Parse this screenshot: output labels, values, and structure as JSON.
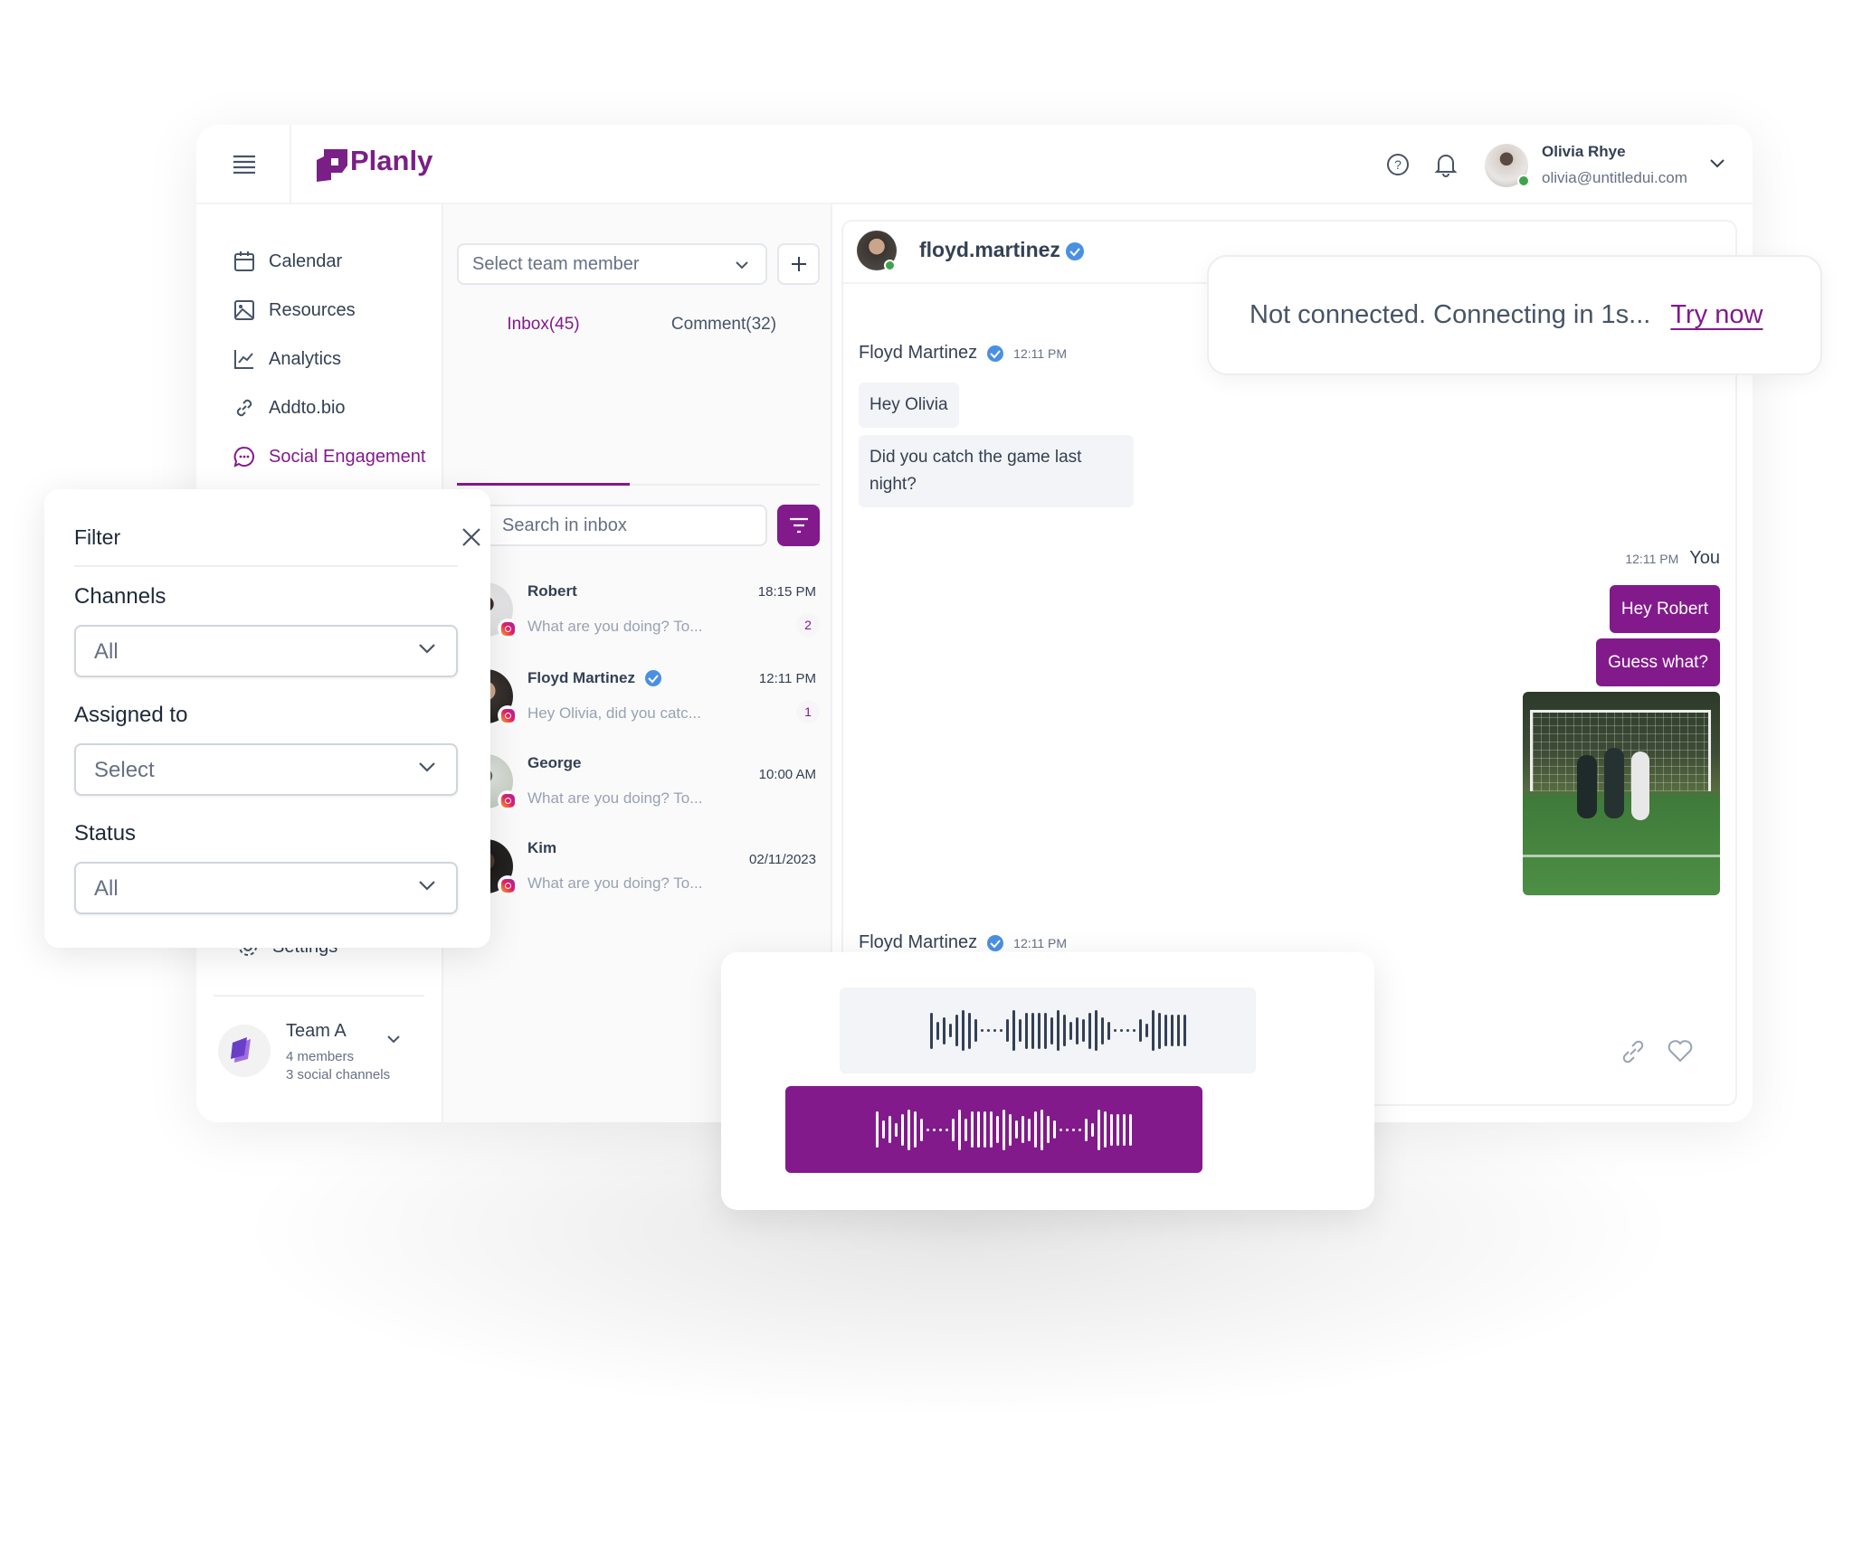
{
  "colors": {
    "brand": "#821a8c",
    "verified": "#4a90e2",
    "online": "#3fa34d"
  },
  "header": {
    "logo_text": "Planly",
    "user": {
      "name": "Olivia Rhye",
      "email": "olivia@untitledui.com"
    },
    "icons": [
      "menu-icon",
      "help-icon",
      "bell-icon",
      "chevron-down-icon"
    ]
  },
  "sidebar": {
    "items": [
      {
        "label": "Calendar",
        "icon": "calendar-icon"
      },
      {
        "label": "Resources",
        "icon": "image-icon"
      },
      {
        "label": "Analytics",
        "icon": "chart-line-icon"
      },
      {
        "label": "Addto.bio",
        "icon": "link-icon"
      },
      {
        "label": "Social Engagement",
        "icon": "chat-icon",
        "active": true
      }
    ],
    "settings_label": "Settings",
    "team": {
      "name": "Team A",
      "members": "4 members",
      "channels": "3 social channels"
    }
  },
  "inbox": {
    "team_select_placeholder": "Select team member",
    "tabs": [
      {
        "label": "Inbox(45)",
        "active": true
      },
      {
        "label": "Comment(32)"
      }
    ],
    "search_placeholder": "Search in inbox",
    "conversations": [
      {
        "name": "Robert",
        "preview": "What are you doing? To...",
        "time": "18:15 PM",
        "unread": "2",
        "verified": false
      },
      {
        "name": "Floyd Martinez",
        "preview": "Hey Olivia, did you catc...",
        "time": "12:11 PM",
        "unread": "1",
        "verified": true
      },
      {
        "name": "George",
        "preview": "What are you doing? To...",
        "time": "10:00 AM"
      },
      {
        "name": "Kim",
        "preview": "What are you doing? To...",
        "time": "02/11/2023"
      }
    ]
  },
  "filter": {
    "title": "Filter",
    "fields": [
      {
        "label": "Channels",
        "value": "All"
      },
      {
        "label": "Assigned to",
        "value": "Select"
      },
      {
        "label": "Status",
        "value": "All"
      }
    ]
  },
  "chat": {
    "username": "floyd.martinez",
    "messages": [
      {
        "sender": "Floyd Martinez",
        "time": "12:11 PM",
        "bubbles": [
          "Hey Olivia",
          "Did you catch the game last night?"
        ]
      },
      {
        "sender": "You",
        "time": "12:11 PM",
        "bubbles": [
          "Hey Robert",
          "Guess what?"
        ]
      },
      {
        "sender": "Floyd Martinez",
        "time": "12:11 PM"
      }
    ]
  },
  "toast": {
    "message": "Not connected. Connecting in 1s...",
    "action": "Try now"
  }
}
